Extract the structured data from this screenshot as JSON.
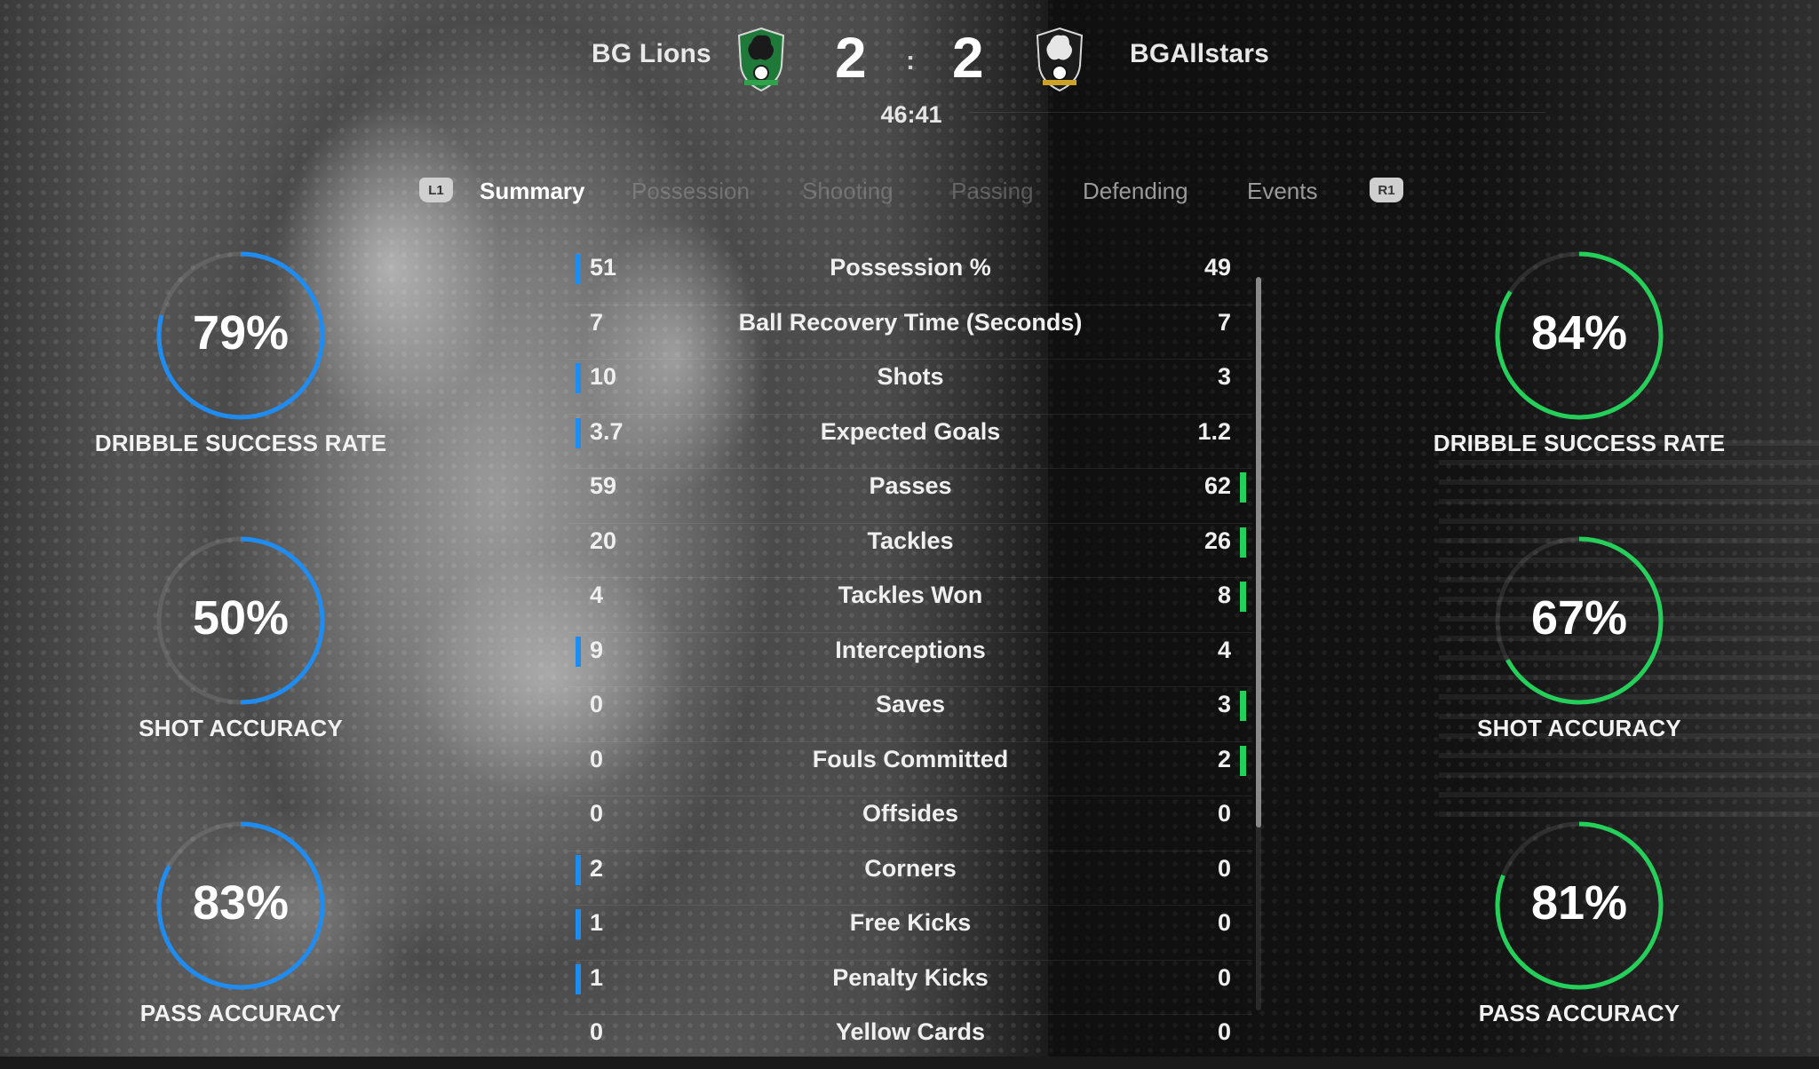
{
  "match": {
    "home_team": "BG Lions",
    "away_team": "BGAllstars",
    "home_score": "2",
    "away_score": "2",
    "separator": ":",
    "clock": "46:41"
  },
  "tabs": {
    "left_bumper": "L1",
    "right_bumper": "R1",
    "items": [
      {
        "label": "Summary",
        "state": "active"
      },
      {
        "label": "Possession",
        "state": "dim"
      },
      {
        "label": "Shooting",
        "state": "dim"
      },
      {
        "label": "Passing",
        "state": "dim"
      },
      {
        "label": "Defending",
        "state": "normal"
      },
      {
        "label": "Events",
        "state": "normal"
      }
    ]
  },
  "colors": {
    "home_accent": "#1e8cf0",
    "away_accent": "#25d05a"
  },
  "stats": [
    {
      "label": "Possession %",
      "home": "51",
      "away": "49",
      "leader": "home"
    },
    {
      "label": "Ball Recovery Time (Seconds)",
      "home": "7",
      "away": "7",
      "leader": "none"
    },
    {
      "label": "Shots",
      "home": "10",
      "away": "3",
      "leader": "home"
    },
    {
      "label": "Expected Goals",
      "home": "3.7",
      "away": "1.2",
      "leader": "home"
    },
    {
      "label": "Passes",
      "home": "59",
      "away": "62",
      "leader": "away"
    },
    {
      "label": "Tackles",
      "home": "20",
      "away": "26",
      "leader": "away"
    },
    {
      "label": "Tackles Won",
      "home": "4",
      "away": "8",
      "leader": "away"
    },
    {
      "label": "Interceptions",
      "home": "9",
      "away": "4",
      "leader": "home"
    },
    {
      "label": "Saves",
      "home": "0",
      "away": "3",
      "leader": "away"
    },
    {
      "label": "Fouls Committed",
      "home": "0",
      "away": "2",
      "leader": "away"
    },
    {
      "label": "Offsides",
      "home": "0",
      "away": "0",
      "leader": "none"
    },
    {
      "label": "Corners",
      "home": "2",
      "away": "0",
      "leader": "home"
    },
    {
      "label": "Free Kicks",
      "home": "1",
      "away": "0",
      "leader": "home"
    },
    {
      "label": "Penalty Kicks",
      "home": "1",
      "away": "0",
      "leader": "home"
    },
    {
      "label": "Yellow Cards",
      "home": "0",
      "away": "0",
      "leader": "none"
    }
  ],
  "home_rings": [
    {
      "value": "79%",
      "fraction": 0.79,
      "label": "DRIBBLE SUCCESS RATE"
    },
    {
      "value": "50%",
      "fraction": 0.5,
      "label": "SHOT ACCURACY"
    },
    {
      "value": "83%",
      "fraction": 0.83,
      "label": "PASS ACCURACY"
    }
  ],
  "away_rings": [
    {
      "value": "84%",
      "fraction": 0.84,
      "label": "DRIBBLE SUCCESS RATE"
    },
    {
      "value": "67%",
      "fraction": 0.67,
      "label": "SHOT ACCURACY"
    },
    {
      "value": "81%",
      "fraction": 0.81,
      "label": "PASS ACCURACY"
    }
  ]
}
